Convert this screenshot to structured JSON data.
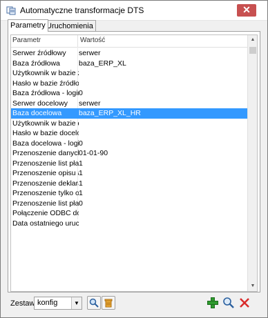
{
  "window": {
    "title": "Automatyczne transformacje DTS"
  },
  "tabs": [
    {
      "label": "Parametry"
    },
    {
      "label": "Uruchomienia"
    }
  ],
  "grid": {
    "columns": [
      "Parametr",
      "Wartość"
    ],
    "rows": [
      {
        "param": "Serwer źródłowy",
        "value": "serwer"
      },
      {
        "param": "Baza źródłowa",
        "value": "baza_ERP_XL"
      },
      {
        "param": "Użytkownik w bazie źródłowej",
        "value": ""
      },
      {
        "param": "Hasło w bazie źródłowej",
        "value": ""
      },
      {
        "param": "Baza źródłowa - login zintegrowany",
        "value": "0"
      },
      {
        "param": "Serwer docelowy",
        "value": "serwer"
      },
      {
        "param": "Baza docelowa",
        "value": "baza_ERP_XL_HR"
      },
      {
        "param": "Użytkownik w bazie docelowej",
        "value": ""
      },
      {
        "param": "Hasło w bazie docelowej",
        "value": ""
      },
      {
        "param": "Baza docelowa - login zintegrowany",
        "value": "0"
      },
      {
        "param": "Przenoszenie danych od dnia",
        "value": "01-01-90"
      },
      {
        "param": "Przenoszenie list płac z HR",
        "value": "1"
      },
      {
        "param": "Przenoszenie opisu analitycznego",
        "value": "1"
      },
      {
        "param": "Przenoszenie deklaracji z HR",
        "value": "1"
      },
      {
        "param": "Przenoszenie tylko ostatnich",
        "value": "1"
      },
      {
        "param": "Przenoszenie list płac z PIT",
        "value": "0"
      },
      {
        "param": "Połączenie ODBC do bazy",
        "value": ""
      },
      {
        "param": "Data ostatniego uruchomienia",
        "value": ""
      }
    ],
    "selected_index": 6
  },
  "bottom": {
    "zestaw_label": "Zestaw:",
    "zestaw_value": "konfig"
  },
  "icons": {
    "app": "dts-app-icon",
    "close": "close-icon",
    "search": "search-icon",
    "delete": "trash-icon",
    "add": "add-icon",
    "preview": "magnifier-icon",
    "remove": "delete-x-icon"
  },
  "colors": {
    "selection": "#3399ff",
    "close_button": "#c75050",
    "add_green": "#2e9a2e",
    "remove_red": "#d92b2b"
  }
}
